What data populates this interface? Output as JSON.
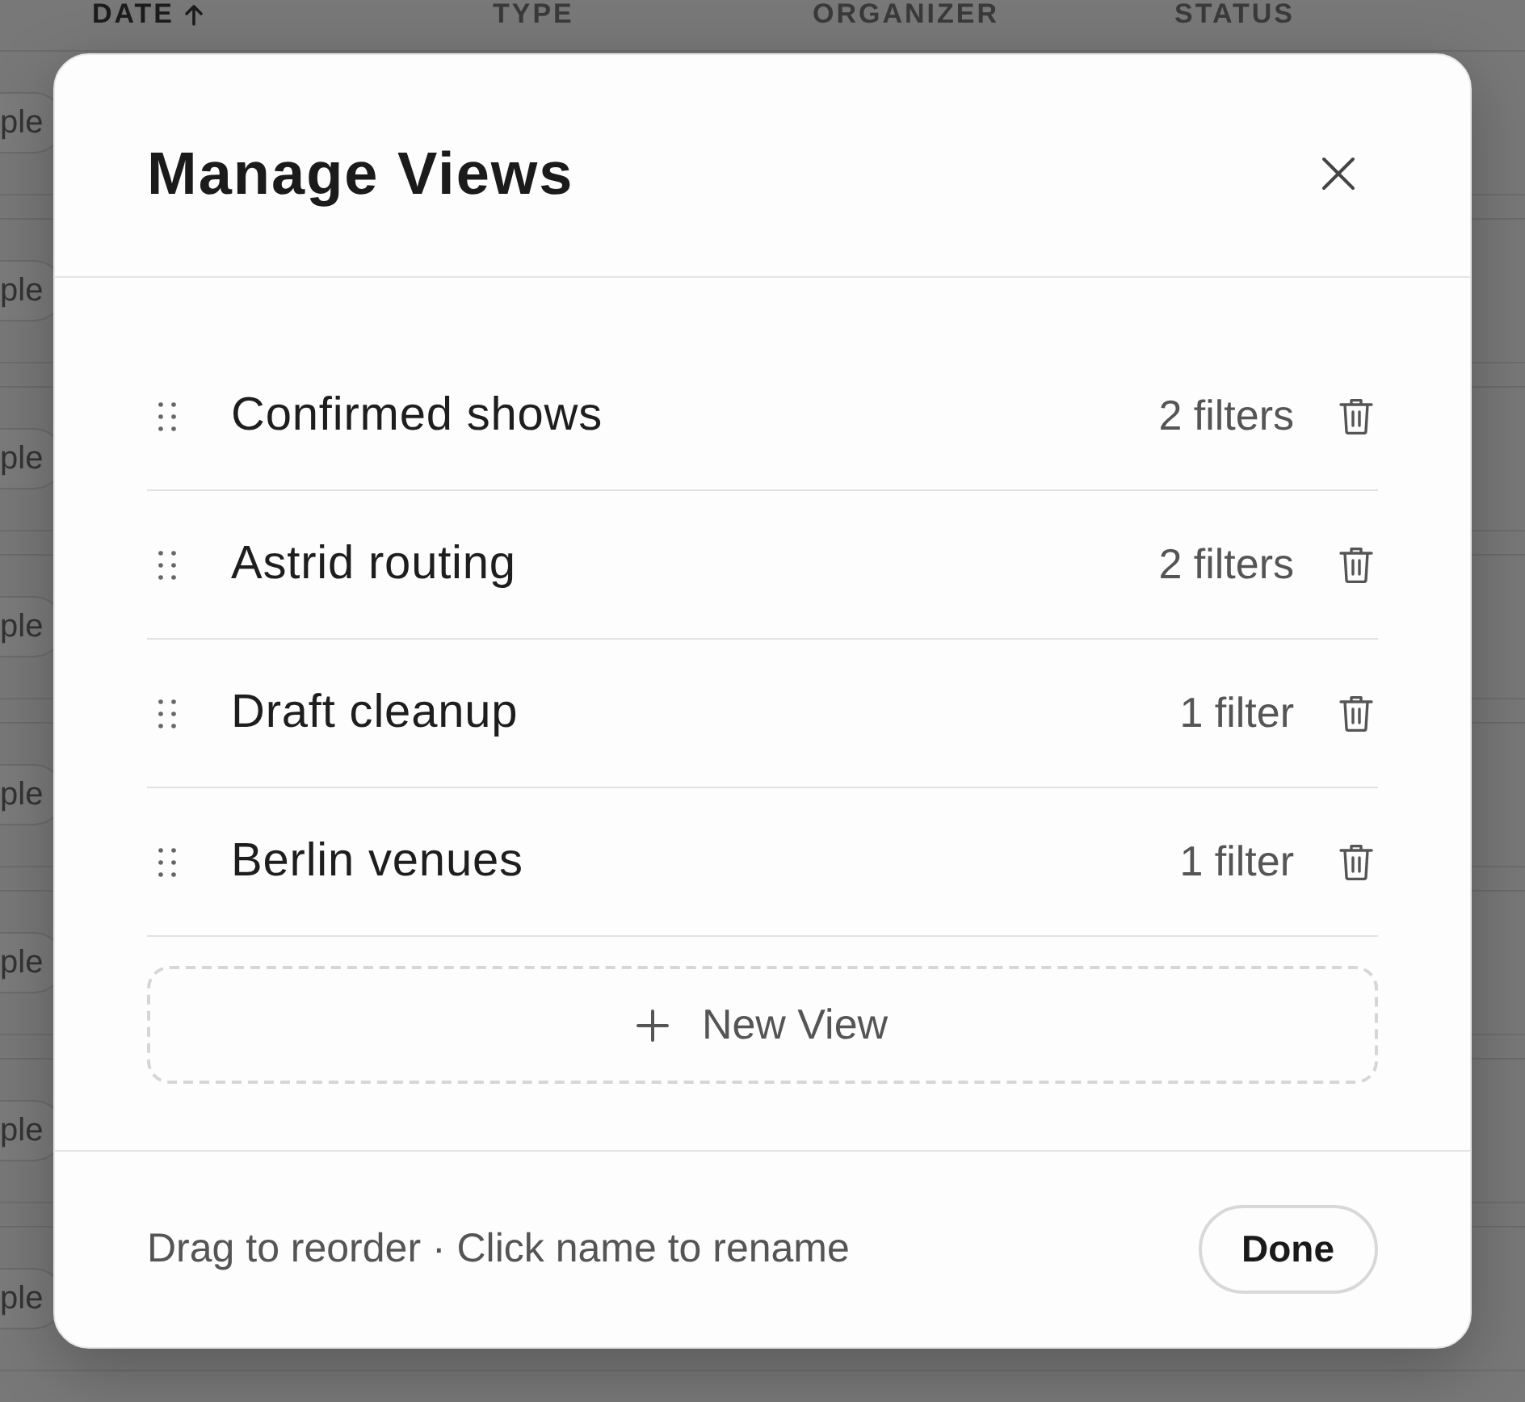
{
  "table": {
    "columns": [
      {
        "label": "DATE",
        "sorted": true
      },
      {
        "label": "TYPE",
        "sorted": false
      },
      {
        "label": "ORGANIZER",
        "sorted": false
      },
      {
        "label": "STATUS",
        "sorted": false
      }
    ],
    "rows": [
      {
        "tag": "ple"
      },
      {
        "tag": "ple"
      },
      {
        "tag": "ple"
      },
      {
        "tag": "ple"
      },
      {
        "tag": "ple"
      },
      {
        "tag": "ple"
      },
      {
        "tag": "ple"
      },
      {
        "tag": "ple"
      }
    ]
  },
  "dialog": {
    "title": "Manage Views",
    "views": [
      {
        "name": "Confirmed shows",
        "filters": "2 filters"
      },
      {
        "name": "Astrid routing",
        "filters": "2 filters"
      },
      {
        "name": "Draft cleanup",
        "filters": "1 filter"
      },
      {
        "name": "Berlin venues",
        "filters": "1 filter"
      }
    ],
    "new_view": "New View",
    "hint": "Drag to reorder · Click name to rename",
    "done": "Done"
  }
}
